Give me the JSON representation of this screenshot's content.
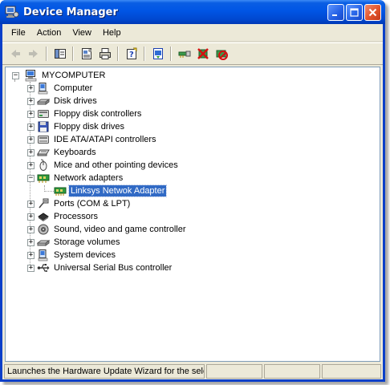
{
  "window": {
    "title": "Device Manager"
  },
  "menu": [
    "File",
    "Action",
    "View",
    "Help"
  ],
  "toolbar": {
    "buttons": [
      "back-icon",
      "forward-icon",
      "show-hide-console-tree-icon",
      "properties-icon",
      "print-icon",
      "help-icon",
      "update-driver-icon",
      "uninstall-icon",
      "disable-icon",
      "scan-hardware-icon"
    ]
  },
  "tree": {
    "root": "MYCOMPUTER",
    "items": [
      {
        "label": "Computer",
        "icon": "computer-icon",
        "expanded": false
      },
      {
        "label": "Disk drives",
        "icon": "disk-drive-icon",
        "expanded": false
      },
      {
        "label": "Floppy disk controllers",
        "icon": "floppy-controller-icon",
        "expanded": false
      },
      {
        "label": "Floppy disk drives",
        "icon": "floppy-drive-icon",
        "expanded": false
      },
      {
        "label": "IDE ATA/ATAPI controllers",
        "icon": "ide-controller-icon",
        "expanded": false
      },
      {
        "label": "Keyboards",
        "icon": "keyboard-icon",
        "expanded": false
      },
      {
        "label": "Mice and other pointing devices",
        "icon": "mouse-icon",
        "expanded": false
      },
      {
        "label": "Network adapters",
        "icon": "network-adapter-icon",
        "expanded": true
      },
      {
        "label": "Ports (COM & LPT)",
        "icon": "port-icon",
        "expanded": false
      },
      {
        "label": "Processors",
        "icon": "processor-icon",
        "expanded": false
      },
      {
        "label": "Sound, video and game controller",
        "icon": "sound-icon",
        "expanded": false
      },
      {
        "label": "Storage volumes",
        "icon": "storage-volume-icon",
        "expanded": false
      },
      {
        "label": "System devices",
        "icon": "system-device-icon",
        "expanded": false
      },
      {
        "label": "Universal Serial Bus controller",
        "icon": "usb-icon",
        "expanded": false
      }
    ],
    "child": {
      "label": "Linksys Netwok Adapter",
      "icon": "network-card-icon",
      "selected": true
    }
  },
  "status": {
    "text": "Launches the Hardware Update Wizard for the selec"
  },
  "colors": {
    "titlebar": "#0055e5",
    "selection": "#316ac5",
    "chrome": "#ece9d8"
  }
}
